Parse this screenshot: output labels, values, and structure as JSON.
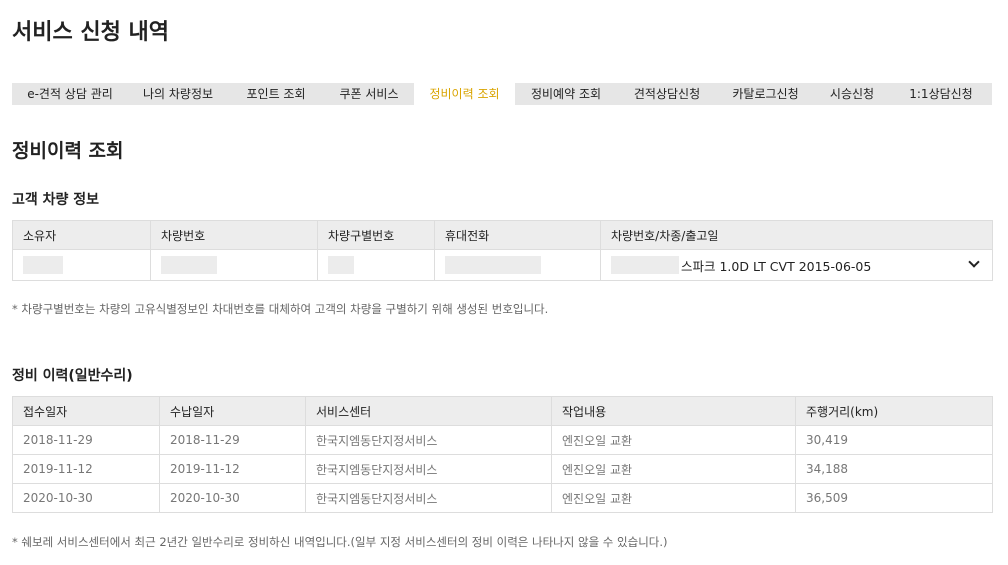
{
  "page_title": "서비스 신청 내역",
  "tabs": [
    {
      "label": "e-견적 상담 관리",
      "active": false
    },
    {
      "label": "나의 차량정보",
      "active": false
    },
    {
      "label": "포인트 조회",
      "active": false
    },
    {
      "label": "쿠폰 서비스",
      "active": false
    },
    {
      "label": "정비이력 조회",
      "active": true
    },
    {
      "label": "정비예약 조회",
      "active": false
    },
    {
      "label": "견적상담신청",
      "active": false
    },
    {
      "label": "카탈로그신청",
      "active": false
    },
    {
      "label": "시승신청",
      "active": false
    },
    {
      "label": "1:1상담신청",
      "active": false
    }
  ],
  "section_title": "정비이력 조회",
  "vehicle_info": {
    "title": "고객 차량 정보",
    "headers": [
      "소유자",
      "차량번호",
      "차량구별번호",
      "휴대전화",
      "차량번호/차종/출고일"
    ],
    "selected_vehicle": "스파크 1.0D LT CVT 2015-06-05",
    "note": "* 차량구별번호는 차량의 고유식별정보인 차대번호를 대체하여 고객의 차량을 구별하기 위해 생성된 번호입니다."
  },
  "history": {
    "title": "정비 이력(일반수리)",
    "headers": [
      "접수일자",
      "수납일자",
      "서비스센터",
      "작업내용",
      "주행거리(km)"
    ],
    "rows": [
      [
        "2018-11-29",
        "2018-11-29",
        "한국지엠동단지정서비스",
        "엔진오일 교환",
        "30,419"
      ],
      [
        "2019-11-12",
        "2019-11-12",
        "한국지엠동단지정서비스",
        "엔진오일 교환",
        "34,188"
      ],
      [
        "2020-10-30",
        "2020-10-30",
        "한국지엠동단지정서비스",
        "엔진오일 교환",
        "36,509"
      ]
    ],
    "note": "* 쉐보레 서비스센터에서 최근 2년간 일반수리로 정비하신 내역입니다.(일부 지정 서비스센터의 정비 이력은 나타나지 않을 수 있습니다.)"
  }
}
